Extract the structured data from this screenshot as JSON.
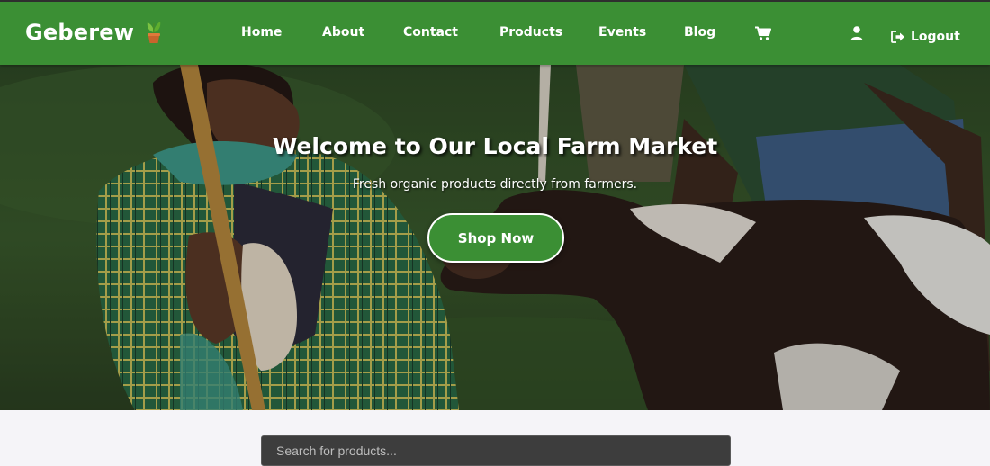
{
  "header": {
    "brand": "Geberew",
    "nav": [
      {
        "label": "Home"
      },
      {
        "label": "About"
      },
      {
        "label": "Contact"
      },
      {
        "label": "Products"
      },
      {
        "label": "Events"
      },
      {
        "label": "Blog"
      }
    ],
    "icons": {
      "brand": "potted-plant-icon",
      "cart": "cart-icon",
      "user": "user-icon",
      "logout": "logout-icon"
    },
    "logout_label": "Logout"
  },
  "hero": {
    "title": "Welcome to Our Local Farm Market",
    "subtitle": "Fresh organic products directly from farmers.",
    "cta_label": "Shop Now"
  },
  "search": {
    "placeholder": "Search for products..."
  },
  "colors": {
    "nav_background": "#3b8f34",
    "cta_background": "#3b8f34",
    "page_background": "#f5f4f8",
    "search_background": "#3d3d3d"
  }
}
